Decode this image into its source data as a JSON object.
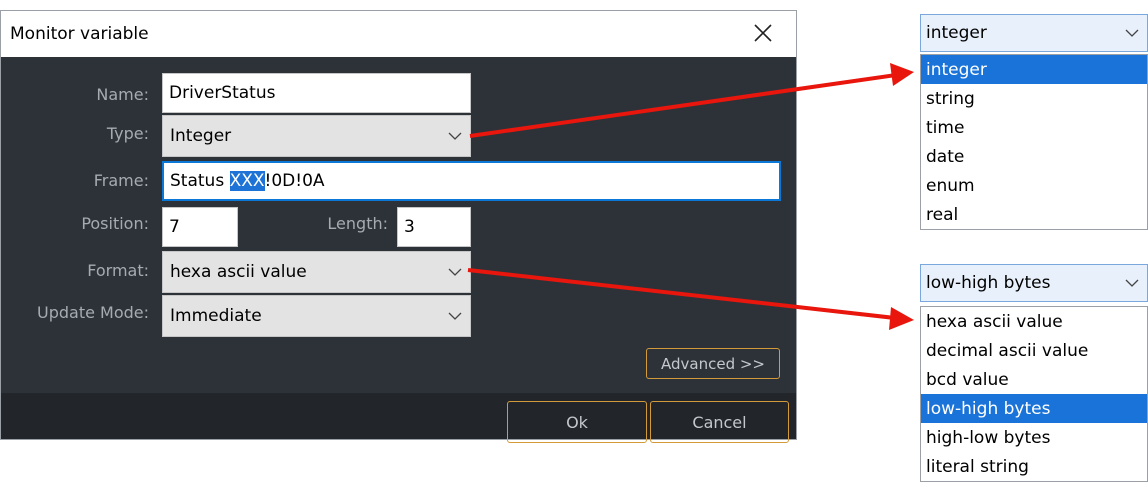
{
  "dialog": {
    "title": "Monitor variable",
    "name_label": "Name:",
    "name_value": "DriverStatus",
    "type_label": "Type:",
    "type_value": "Integer",
    "frame_label": "Frame:",
    "frame_value_prefix": "Status ",
    "frame_value_selected": "XXX",
    "frame_value_suffix": "!0D!0A",
    "position_label": "Position:",
    "position_value": "7",
    "length_label": "Length:",
    "length_value": "3",
    "format_label": "Format:",
    "format_value": "hexa ascii value",
    "update_label": "Update Mode:",
    "update_value": "Immediate",
    "advanced_label": "Advanced >>",
    "ok_label": "Ok",
    "cancel_label": "Cancel"
  },
  "type_dropdown": {
    "selected": "integer",
    "options": [
      "integer",
      "string",
      "time",
      "date",
      "enum",
      "real"
    ],
    "highlighted_index": 0
  },
  "format_dropdown": {
    "selected": "low-high bytes",
    "options": [
      "hexa ascii value",
      "decimal ascii value",
      "bcd value",
      "low-high bytes",
      "high-low bytes",
      "literal string"
    ],
    "highlighted_index": 3
  },
  "colors": {
    "dialog_bg": "#2d3239",
    "accent_orange": "#d39a3a",
    "selection_blue": "#1a73d8",
    "arrow_red": "#e8160c"
  },
  "icons": {
    "close": "close-icon",
    "chevron": "chevron-down-icon"
  }
}
